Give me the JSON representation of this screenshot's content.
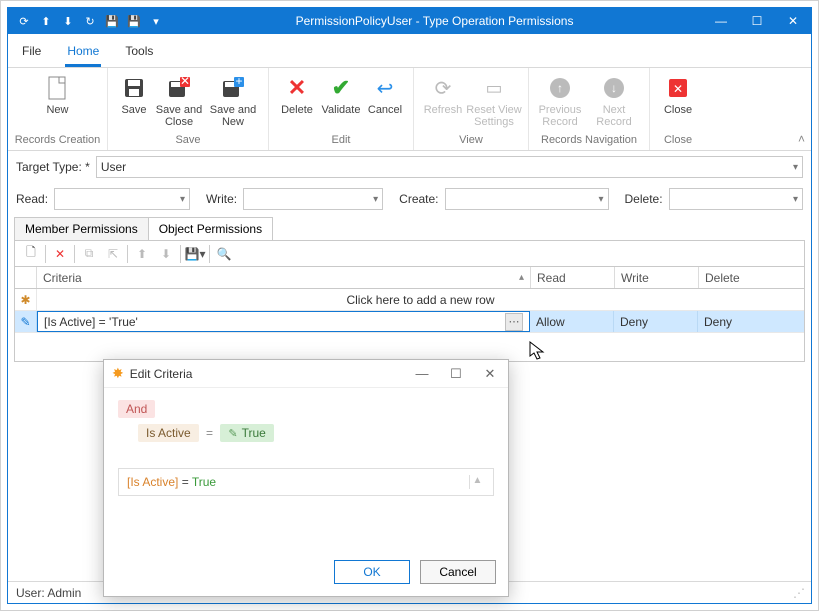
{
  "window": {
    "title": "PermissionPolicyUser - Type Operation Permissions",
    "qat_icons": [
      "refresh-down-icon",
      "nav-up-icon",
      "nav-down-icon",
      "sync-icon",
      "save-icon",
      "save-close-icon",
      "dropdown-icon"
    ]
  },
  "menu": {
    "file": "File",
    "home": "Home",
    "tools": "Tools"
  },
  "ribbon": {
    "groups": {
      "records_creation": {
        "caption": "Records Creation",
        "new": "New"
      },
      "save": {
        "caption": "Save",
        "save": "Save",
        "save_close": "Save and Close",
        "save_new": "Save and New"
      },
      "edit": {
        "caption": "Edit",
        "delete": "Delete",
        "validate": "Validate",
        "cancel": "Cancel"
      },
      "view": {
        "caption": "View",
        "refresh": "Refresh",
        "reset": "Reset View Settings"
      },
      "nav": {
        "caption": "Records Navigation",
        "prev": "Previous Record",
        "next": "Next Record"
      },
      "close": {
        "caption": "Close",
        "close": "Close"
      }
    }
  },
  "form": {
    "target_type_label": "Target Type: *",
    "target_type_value": "User",
    "read_label": "Read:",
    "write_label": "Write:",
    "create_label": "Create:",
    "delete_label": "Delete:"
  },
  "tabs": {
    "member": "Member Permissions",
    "object": "Object Permissions"
  },
  "grid": {
    "columns": {
      "criteria": "Criteria",
      "read": "Read",
      "write": "Write",
      "delete": "Delete"
    },
    "add_row_text": "Click here to add a new row",
    "rows": [
      {
        "criteria": "[Is Active] = 'True'",
        "read": "Allow",
        "write": "Deny",
        "delete": "Deny"
      }
    ]
  },
  "status": {
    "user": "User: Admin"
  },
  "dialog": {
    "title": "Edit Criteria",
    "group_op": "And",
    "field": "Is Active",
    "value": "True",
    "expr_field": "[Is Active]",
    "expr_eq": " = ",
    "expr_val": "True",
    "ok": "OK",
    "cancel": "Cancel"
  }
}
